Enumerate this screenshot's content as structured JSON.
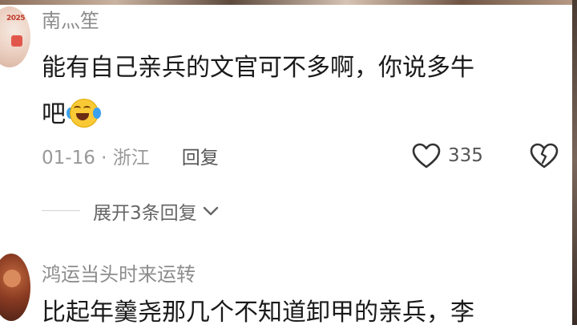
{
  "comments": [
    {
      "username": "南灬笙",
      "text_line1": "能有自己亲兵的文官可不多啊，你说多牛",
      "text_line2": "吧",
      "emoji": "laughing-crying-emoji",
      "date_location": "01-16 · 浙江",
      "reply_label": "回复",
      "likes": "335",
      "expand_label": "展开3条回复"
    },
    {
      "username": "鸿运当头时来运转",
      "text_line1": "比起年羹尧那几个不知道卸甲的亲兵，李"
    }
  ],
  "icons": {
    "like": "heart-outline-icon",
    "dislike": "broken-heart-icon",
    "expand": "chevron-down-icon"
  },
  "colors": {
    "text_primary": "#1a1a1a",
    "text_secondary": "#8c8c8c",
    "background": "#ffffff"
  }
}
